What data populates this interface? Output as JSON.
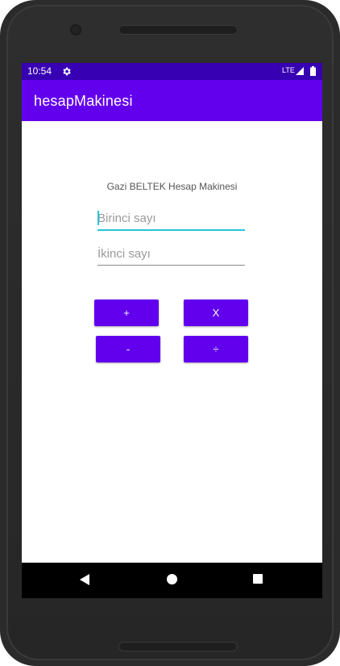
{
  "status_bar": {
    "time": "10:54",
    "network": "LTE",
    "settings_icon": "gear-icon",
    "signal_icon": "signal-icon",
    "battery_icon": "battery-icon"
  },
  "app_bar": {
    "title": "hesapMakinesi"
  },
  "main": {
    "heading": "Gazi BELTEK Hesap Makinesi",
    "first_number": {
      "value": "",
      "placeholder": "Birinci sayı"
    },
    "second_number": {
      "value": "",
      "placeholder": "İkinci sayı"
    },
    "buttons": {
      "add": "+",
      "multiply": "X",
      "subtract": "-",
      "divide": "÷"
    }
  },
  "nav_bar": {
    "back_icon": "back-icon",
    "home_icon": "home-icon",
    "recents_icon": "recents-icon"
  },
  "colors": {
    "status_bar": "#3700b3",
    "primary": "#6200ee",
    "accent": "#26c6da",
    "device_frame": "#2b2b2b"
  }
}
